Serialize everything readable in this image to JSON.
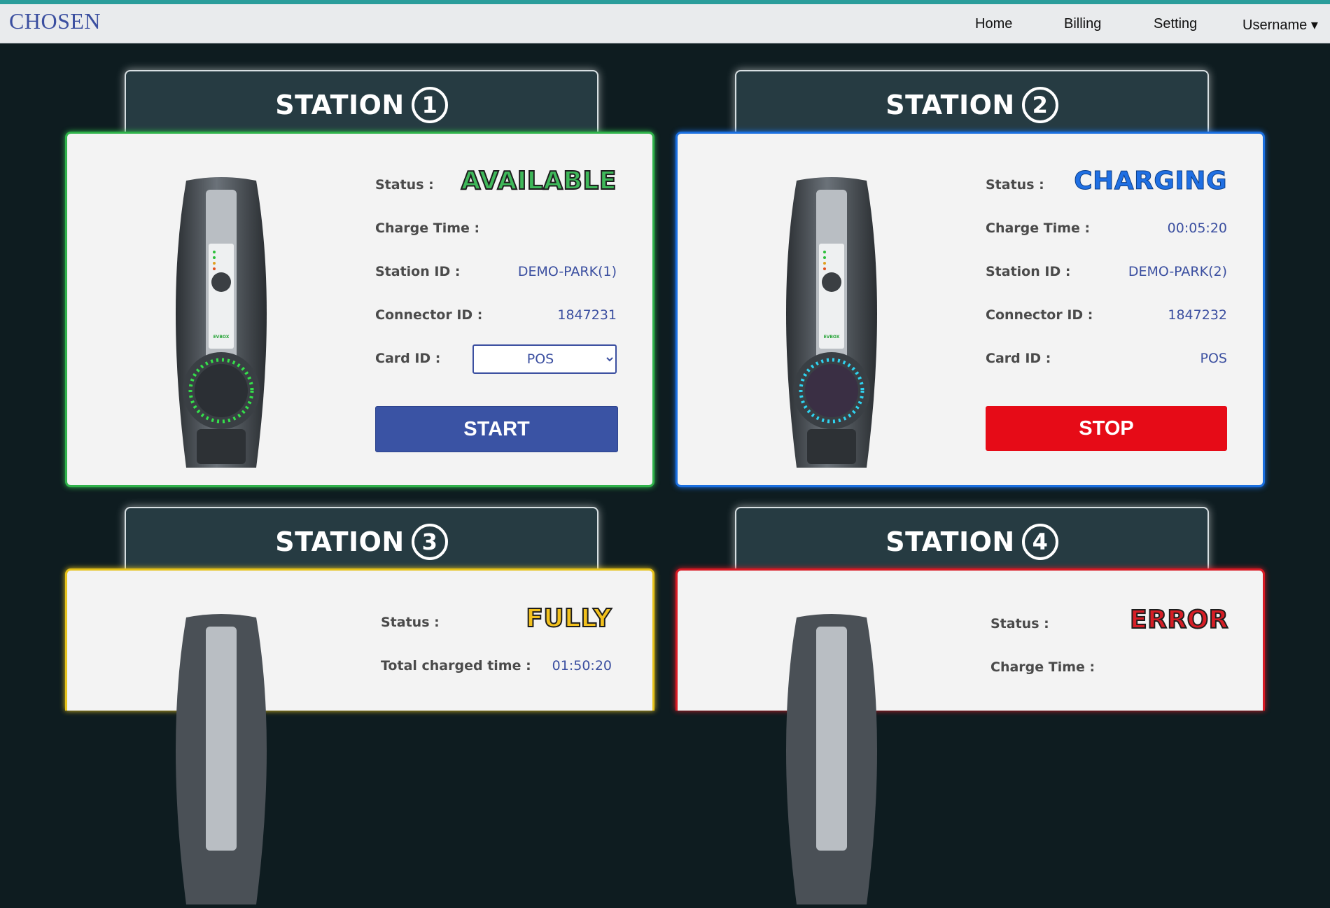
{
  "navbar": {
    "brand": "CHOSEN",
    "items": [
      {
        "label": "Home"
      },
      {
        "label": "Billing"
      },
      {
        "label": "Setting"
      },
      {
        "label": "Username ▾"
      }
    ]
  },
  "colors": {
    "available": "#3fb85a",
    "charging": "#1f6fe3",
    "fully": "#f2c11e",
    "error": "#d71e26",
    "accent": "#3b4fa0",
    "stop_button": "#e60b17",
    "start_button": "#3a53a4"
  },
  "stations": [
    {
      "title": "STATION",
      "number": "1",
      "status_label": "Status :",
      "status": "AVAILABLE",
      "charge_time_label": "Charge Time :",
      "charge_time": "",
      "station_id_label": "Station ID :",
      "station_id": "DEMO-PARK(1)",
      "connector_id_label": "Connector ID :",
      "connector_id": "1847231",
      "card_id_label": "Card ID :",
      "card_id": "POS",
      "button": "START",
      "led_color": "green"
    },
    {
      "title": "STATION",
      "number": "2",
      "status_label": "Status :",
      "status": "CHARGING",
      "charge_time_label": "Charge Time :",
      "charge_time": "00:05:20",
      "station_id_label": "Station ID :",
      "station_id": "DEMO-PARK(2)",
      "connector_id_label": "Connector ID :",
      "connector_id": "1847232",
      "card_id_label": "Card ID :",
      "card_id": "POS",
      "button": "STOP",
      "led_color": "cyan"
    },
    {
      "title": "STATION",
      "number": "3",
      "status_label": "Status :",
      "status": "FULLY",
      "total_time_label": "Total charged time :",
      "total_time": "01:50:20"
    },
    {
      "title": "STATION",
      "number": "4",
      "status_label": "Status :",
      "status": "ERROR",
      "charge_time_label": "Charge Time :",
      "charge_time": ""
    }
  ]
}
